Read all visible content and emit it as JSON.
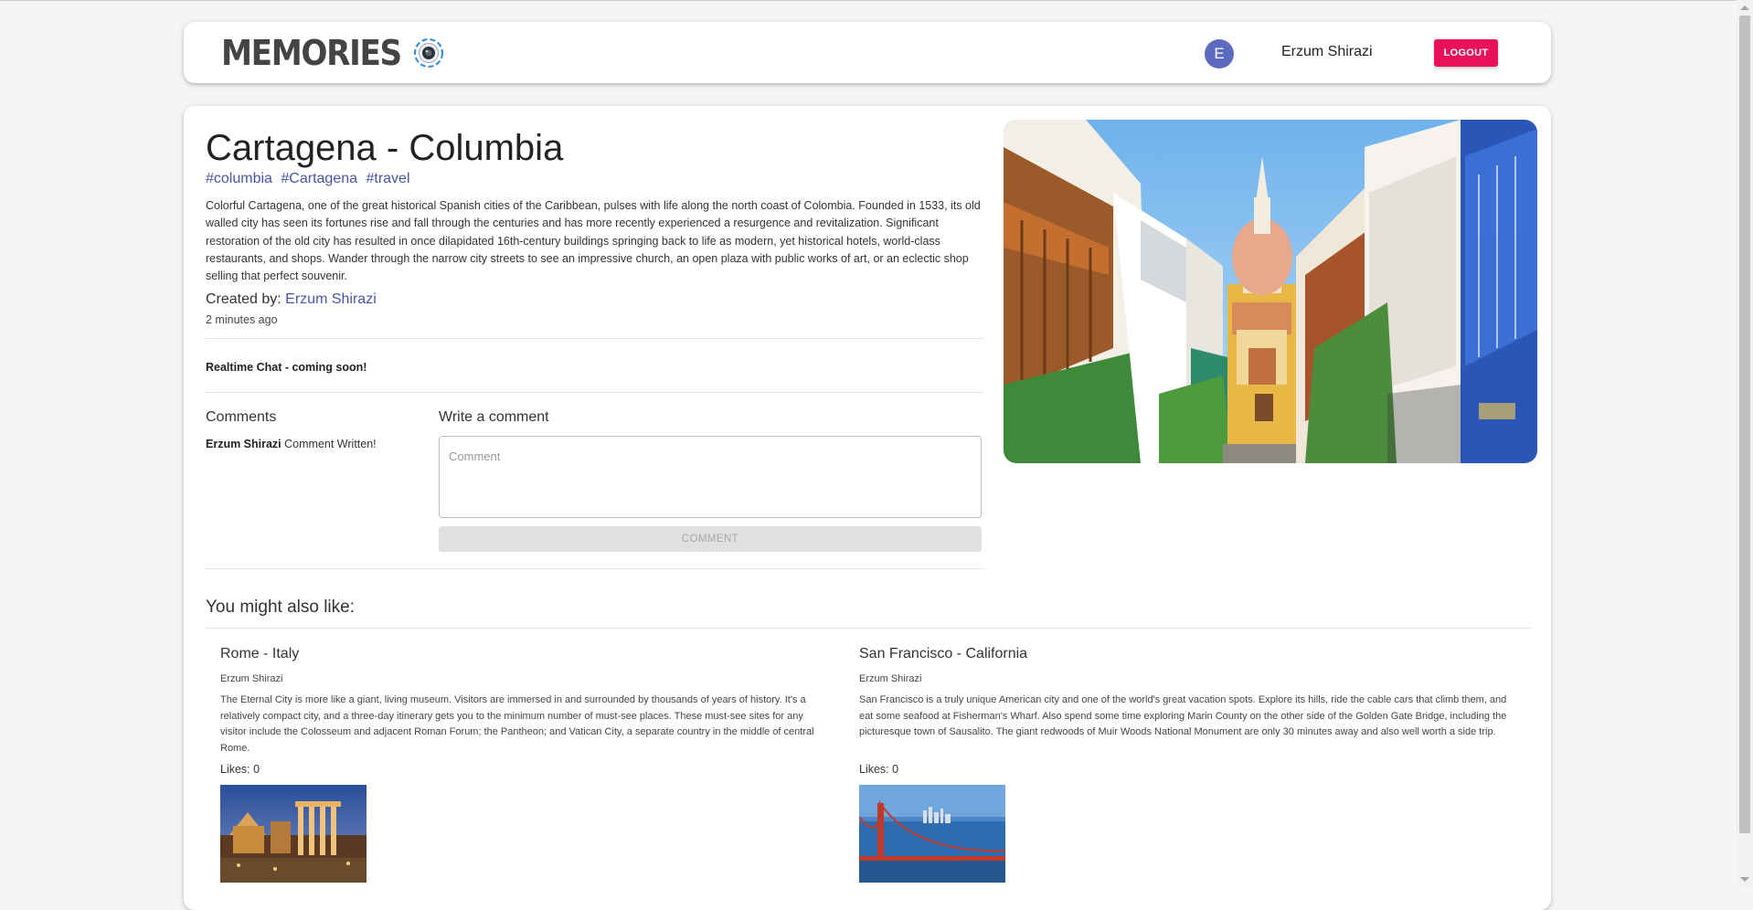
{
  "header": {
    "brand": "MEMORIES",
    "avatar_initial": "E",
    "username": "Erzum Shirazi",
    "logout_label": "LOGOUT"
  },
  "post": {
    "title": "Cartagena - Columbia",
    "tags": [
      "#columbia",
      "#Cartagena",
      "#travel"
    ],
    "description": "Colorful Cartagena, one of the great historical Spanish cities of the Caribbean, pulses with life along the north coast of Colombia. Founded in 1533, its old walled city has seen its fortunes rise and fall through the centuries and has more recently experienced a resurgence and revitalization. Significant restoration of the old city has resulted in once dilapidated 16th-century buildings springing back to life as modern, yet historical hotels, world-class restaurants, and shops. Wander through the narrow city streets to see an impressive church, an open plaza with public works of art, or an eclectic shop selling that perfect souvenir.",
    "created_by_label": "Created by:",
    "created_by": "Erzum Shirazi",
    "time_ago": "2 minutes ago"
  },
  "realtime_chat": "Realtime Chat - coming soon!",
  "comments": {
    "heading": "Comments",
    "items": [
      {
        "author": "Erzum Shirazi",
        "text": "Comment Written!"
      }
    ],
    "write_heading": "Write a comment",
    "placeholder": "Comment",
    "button_label": "COMMENT"
  },
  "recommendations": {
    "heading": "You might also like:",
    "items": [
      {
        "title": "Rome - Italy",
        "author": "Erzum Shirazi",
        "description": "The Eternal City is more like a giant, living museum. Visitors are immersed in and surrounded by thousands of years of history. It's a relatively compact city, and a three-day itinerary gets you to the minimum number of must-see places. These must-see sites for any visitor include the Colosseum and adjacent Roman Forum; the Pantheon; and Vatican City, a separate country in the middle of central Rome.",
        "likes": "Likes: 0"
      },
      {
        "title": "San Francisco - California",
        "author": "Erzum Shirazi",
        "description": "San Francisco is a truly unique American city and one of the world's great vacation spots. Explore its hills, ride the cable cars that climb them, and eat some seafood at Fisherman's Wharf. Also spend some time exploring Marin County on the other side of the Golden Gate Bridge, including the picturesque town of Sausalito. The giant redwoods of Muir Woods National Monument are only 30 minutes away and also well worth a side trip.",
        "likes": "Likes: 0"
      }
    ]
  },
  "colors": {
    "accent": "#e8115a",
    "link": "#4a55a2",
    "avatar": "#5c6bc0"
  }
}
